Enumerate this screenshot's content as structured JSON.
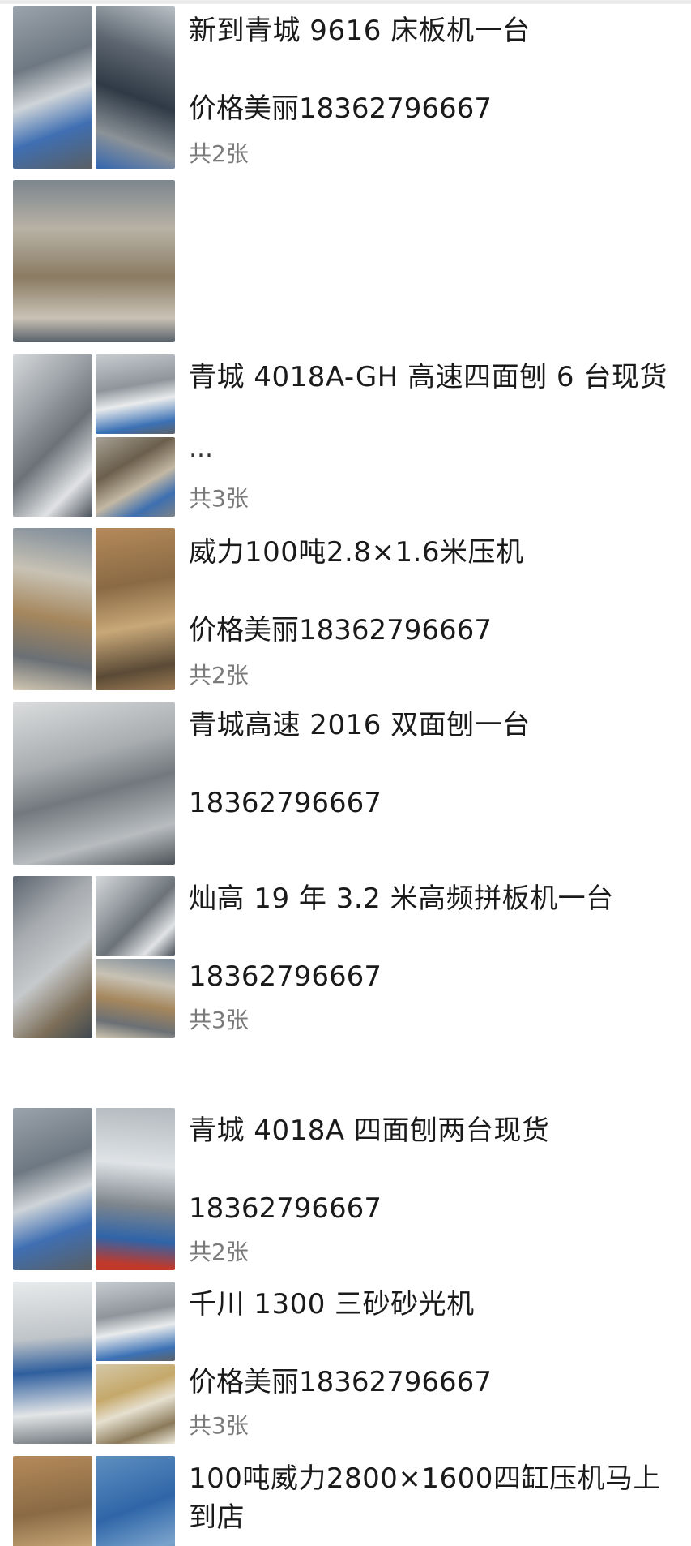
{
  "posts": [
    {
      "title": "新到青城 9616 床板机一台",
      "line2": "价格美丽18362796667",
      "count": "共2张",
      "images": [
        "machine-photo-1",
        "machine-photo-2",
        "machine-photo-3"
      ]
    },
    {
      "title": "青城 4018A-GH 高速四面刨 6 台现货",
      "more": "…",
      "count": "共3张",
      "images": [
        "planer-photo-1",
        "planer-photo-2",
        "planer-photo-3"
      ]
    },
    {
      "title": "威力100吨2.8×1.6米压机",
      "line2": "价格美丽18362796667",
      "count": "共2张",
      "images": [
        "press-photo-1",
        "press-photo-2"
      ]
    },
    {
      "title": "青城高速 2016 双面刨一台",
      "line2": "18362796667",
      "images": [
        "double-planer-photo"
      ]
    },
    {
      "title": "灿高 19 年 3.2 米高频拼板机一台",
      "line2": "18362796667",
      "count": "共3张",
      "images": [
        "splicer-photo-1",
        "splicer-photo-2",
        "splicer-photo-3"
      ]
    },
    {
      "title": "青城 4018A 四面刨两台现货",
      "line2": "18362796667",
      "count": "共2张",
      "images": [
        "4018a-photo-1",
        "4018a-photo-2"
      ]
    },
    {
      "title": "千川 1300 三砂砂光机",
      "line2": "价格美丽18362796667",
      "count": "共3张",
      "images": [
        "sander-photo-1",
        "sander-photo-2",
        "sander-photo-3"
      ]
    },
    {
      "title": "100吨威力2800×1600四缸压机马上到店",
      "images": [
        "press-4cyl-photo-1",
        "press-4cyl-photo-2"
      ]
    }
  ]
}
